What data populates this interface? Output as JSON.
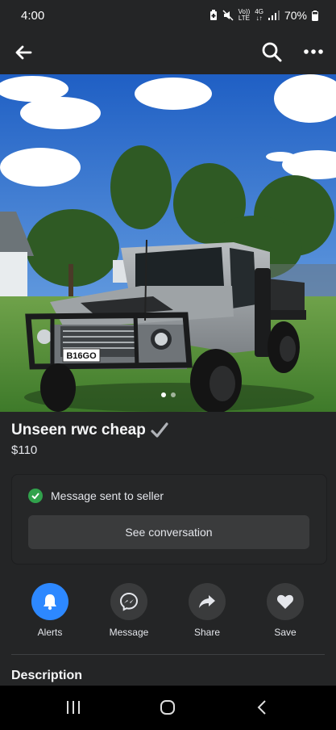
{
  "status": {
    "time": "4:00",
    "net_top": "Vo))",
    "net_bottom": "LTE",
    "gen_top": "4G",
    "gen_bottom": "↓↑",
    "battery": "70%"
  },
  "listing": {
    "title": "Unseen rwc cheap",
    "price": "$110",
    "photo_count": 2,
    "active_photo": 1,
    "plate": "B16GO"
  },
  "message": {
    "sent_text": "Message sent to seller",
    "button": "See conversation"
  },
  "actions": [
    {
      "label": "Alerts",
      "icon": "bell-icon"
    },
    {
      "label": "Message",
      "icon": "messenger-icon"
    },
    {
      "label": "Share",
      "icon": "share-icon"
    },
    {
      "label": "Save",
      "icon": "heart-icon"
    }
  ],
  "description_heading": "Description",
  "colors": {
    "background": "#242526",
    "accent": "#2d88ff",
    "success": "#31a24c"
  }
}
